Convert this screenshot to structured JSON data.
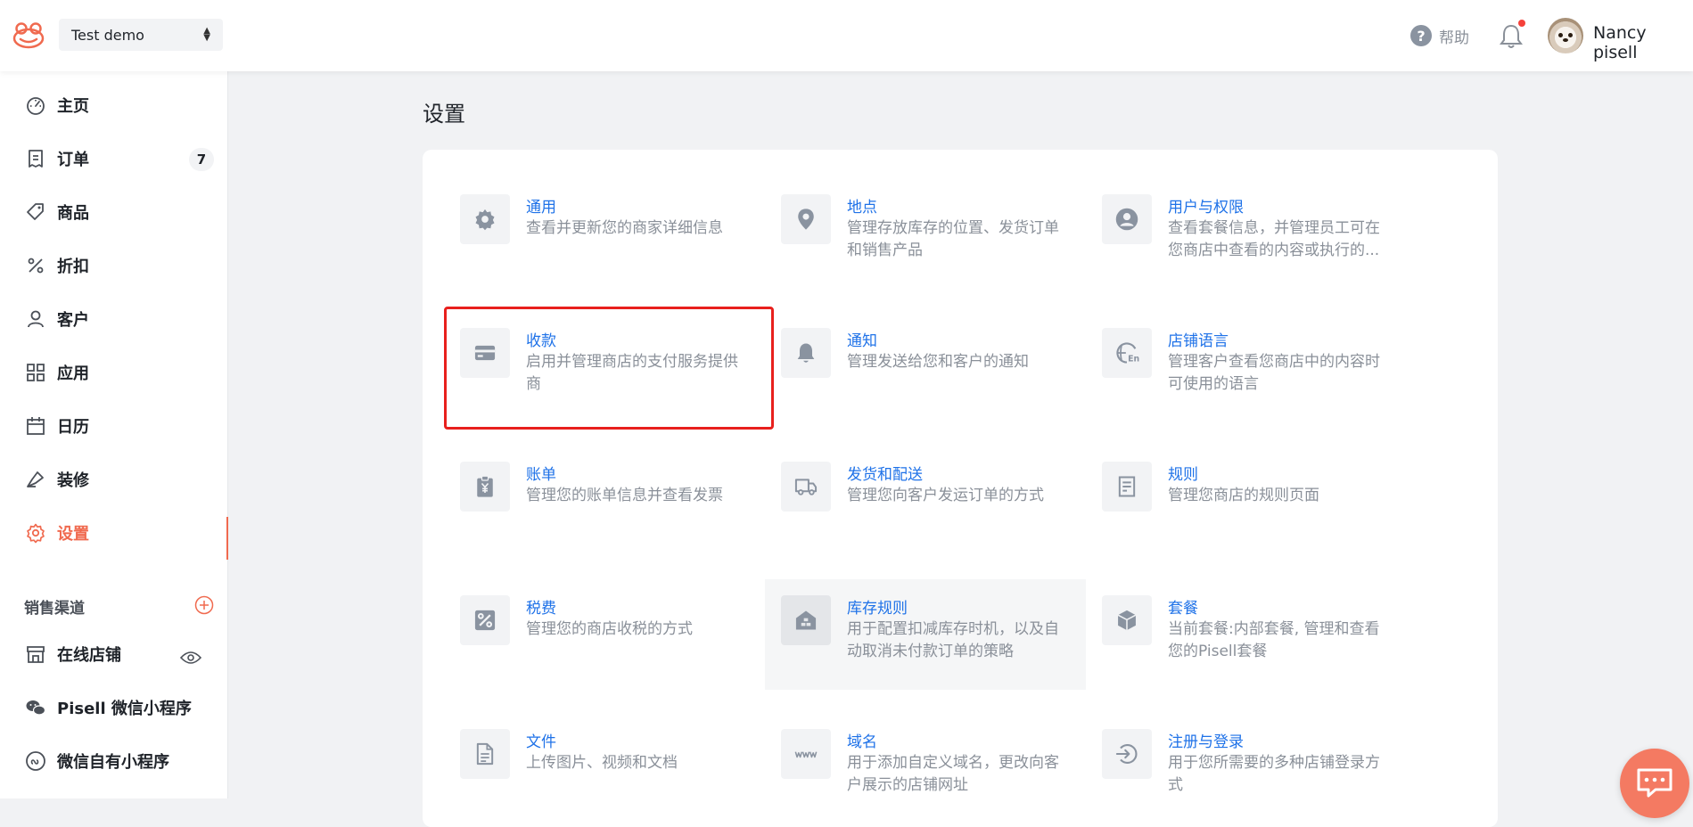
{
  "header": {
    "store_name": "Test demo",
    "help_label": "帮助",
    "user_name": "Nancy pisell",
    "has_notification": true
  },
  "sidebar": {
    "items": [
      {
        "label": "主页",
        "icon": "dashboard-icon"
      },
      {
        "label": "订单",
        "icon": "order-icon",
        "badge": "7"
      },
      {
        "label": "商品",
        "icon": "tag-icon"
      },
      {
        "label": "折扣",
        "icon": "percent-icon"
      },
      {
        "label": "客户",
        "icon": "user-icon"
      },
      {
        "label": "应用",
        "icon": "apps-icon"
      },
      {
        "label": "日历",
        "icon": "calendar-icon"
      },
      {
        "label": "装修",
        "icon": "brush-icon"
      },
      {
        "label": "设置",
        "icon": "gear-icon",
        "active": true
      }
    ],
    "channels_title": "销售渠道",
    "channels": [
      {
        "label": "在线店铺",
        "icon": "store-icon"
      },
      {
        "label": "Pisell 微信小程序",
        "icon": "wechat-icon"
      },
      {
        "label": "微信自有小程序",
        "icon": "mini-program-icon"
      }
    ]
  },
  "main": {
    "title": "设置",
    "settings": [
      {
        "title": "通用",
        "desc": "查看并更新您的商家详细信息",
        "icon": "gear-icon"
      },
      {
        "title": "地点",
        "desc": "管理存放库存的位置、发货订单和销售产品",
        "icon": "location-pin-icon"
      },
      {
        "title": "用户与权限",
        "desc": "查看套餐信息，并管理员工可在您商店中查看的内容或执行的...",
        "icon": "user-circle-icon"
      },
      {
        "title": "收款",
        "desc": "启用并管理商店的支付服务提供商",
        "icon": "credit-card-icon"
      },
      {
        "title": "通知",
        "desc": "管理发送给您和客户的通知",
        "icon": "bell-icon"
      },
      {
        "title": "店铺语言",
        "desc": "管理客户查看您商店中的内容时可使用的语言",
        "icon": "language-icon"
      },
      {
        "title": "账单",
        "desc": "管理您的账单信息并查看发票",
        "icon": "bill-icon"
      },
      {
        "title": "发货和配送",
        "desc": "管理您向客户发运订单的方式",
        "icon": "truck-icon"
      },
      {
        "title": "规则",
        "desc": "管理您商店的规则页面",
        "icon": "rules-icon"
      },
      {
        "title": "税费",
        "desc": "管理您的商店收税的方式",
        "icon": "tax-percent-icon"
      },
      {
        "title": "库存规则",
        "desc": "用于配置扣减库存时机，以及自动取消未付款订单的策略",
        "icon": "warehouse-icon"
      },
      {
        "title": "套餐",
        "desc": "当前套餐:内部套餐, 管理和查看您的Pisell套餐",
        "icon": "package-box-icon"
      },
      {
        "title": "文件",
        "desc": "上传图片、视频和文档",
        "icon": "file-icon"
      },
      {
        "title": "域名",
        "desc": "用于添加自定义域名，更改向客户展示的店铺网址",
        "icon": "domain-www-icon"
      },
      {
        "title": "注册与登录",
        "desc": "用于您所需要的多种店铺登录方式",
        "icon": "login-icon"
      }
    ]
  },
  "colors": {
    "accent": "#f06a4f",
    "link": "#1f72e8",
    "highlight": "#e8201d"
  }
}
